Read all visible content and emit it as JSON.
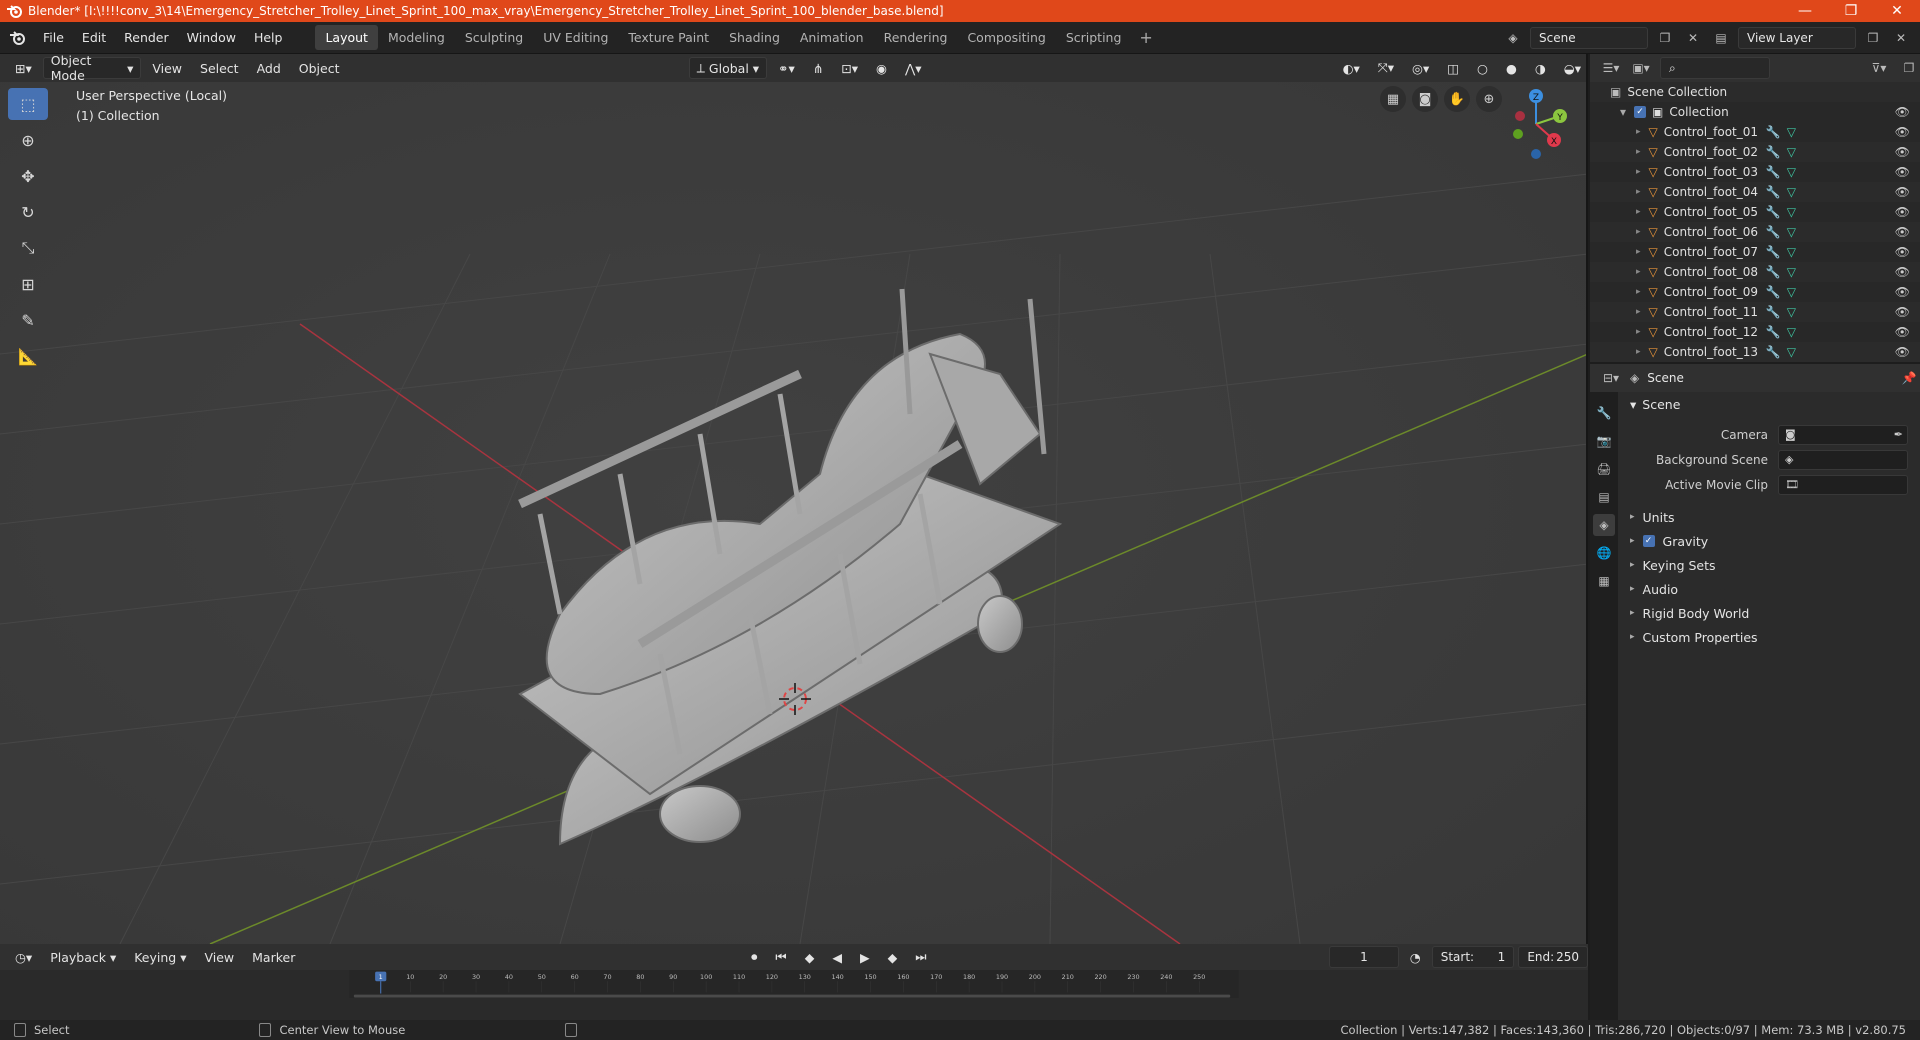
{
  "title_bar": {
    "title": "Blender* [I:\\!!!!conv_3\\14\\Emergency_Stretcher_Trolley_Linet_Sprint_100_max_vray\\Emergency_Stretcher_Trolley_Linet_Sprint_100_blender_base.blend]",
    "minimize": "—",
    "maximize": "❐",
    "close": "✕"
  },
  "menu": {
    "items": [
      "File",
      "Edit",
      "Render",
      "Window",
      "Help"
    ]
  },
  "workspaces": {
    "tabs": [
      "Layout",
      "Modeling",
      "Sculpting",
      "UV Editing",
      "Texture Paint",
      "Shading",
      "Animation",
      "Rendering",
      "Compositing",
      "Scripting"
    ],
    "active": "Layout",
    "add": "+"
  },
  "scene_selector": {
    "value": "Scene"
  },
  "view_layer_selector": {
    "value": "View Layer"
  },
  "viewport_header": {
    "mode": "Object Mode",
    "menus": [
      "View",
      "Select",
      "Add",
      "Object"
    ],
    "orientation": "Global"
  },
  "viewport": {
    "perspective_label": "User Perspective (Local)",
    "collection_label": "(1) Collection",
    "gizmo_axes": [
      "X",
      "Y",
      "Z"
    ]
  },
  "outliner": {
    "root": "Scene Collection",
    "collection": "Collection",
    "objects": [
      "Control_foot_01",
      "Control_foot_02",
      "Control_foot_03",
      "Control_foot_04",
      "Control_foot_05",
      "Control_foot_06",
      "Control_foot_07",
      "Control_foot_08",
      "Control_foot_09",
      "Control_foot_11",
      "Control_foot_12",
      "Control_foot_13"
    ]
  },
  "properties": {
    "context": "Scene",
    "panel_title": "Scene",
    "fields": {
      "camera": "Camera",
      "background_scene": "Background Scene",
      "active_movie_clip": "Active Movie Clip"
    },
    "subpanels": [
      "Units",
      "Gravity",
      "Keying Sets",
      "Audio",
      "Rigid Body World",
      "Custom Properties"
    ],
    "gravity_checked": true
  },
  "timeline": {
    "menus": [
      "Playback",
      "Keying",
      "View",
      "Marker"
    ],
    "current_frame": "1",
    "start_label": "Start:",
    "start": "1",
    "end_label": "End:",
    "end": "250",
    "ruler_ticks": [
      "1",
      "10",
      "20",
      "30",
      "40",
      "50",
      "60",
      "70",
      "80",
      "90",
      "100",
      "110",
      "120",
      "130",
      "140",
      "150",
      "160",
      "170",
      "180",
      "190",
      "200",
      "210",
      "220",
      "230",
      "240",
      "250"
    ]
  },
  "status_bar": {
    "left_action": "Select",
    "middle_action": "Center View to Mouse",
    "stats": "Collection | Verts:147,382 | Faces:143,360 | Tris:286,720 | Objects:0/97 | Mem: 73.3 MB | v2.80.75"
  },
  "colors": {
    "title_bar": "#e0481a",
    "accent": "#4772b3",
    "object_icon": "#e8953a",
    "modifier_icon": "#6e9fe0",
    "mesh_icon": "#3fc7a2",
    "axis_x": "#e0394c",
    "axis_y": "#8cc63f",
    "axis_z": "#3c8fe0"
  }
}
